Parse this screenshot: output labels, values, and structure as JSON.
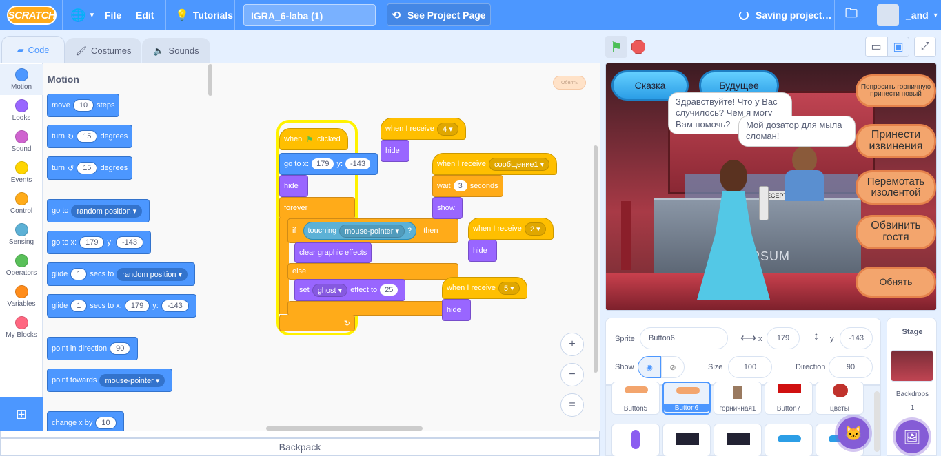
{
  "menubar": {
    "logo": "SCRATCH",
    "file": "File",
    "edit": "Edit",
    "tutorials": "Tutorials",
    "project_title": "IGRA_6-laba (1)",
    "see_project": "See Project Page",
    "saving": "Saving project…",
    "username": "_and"
  },
  "tabs": {
    "code": "Code",
    "costumes": "Costumes",
    "sounds": "Sounds"
  },
  "categories": [
    {
      "label": "Motion",
      "color": "#4c97ff"
    },
    {
      "label": "Looks",
      "color": "#9966ff"
    },
    {
      "label": "Sound",
      "color": "#cf63cf"
    },
    {
      "label": "Events",
      "color": "#ffd500"
    },
    {
      "label": "Control",
      "color": "#ffab19"
    },
    {
      "label": "Sensing",
      "color": "#5cb1d6"
    },
    {
      "label": "Operators",
      "color": "#59c059"
    },
    {
      "label": "Variables",
      "color": "#ff8c1a"
    },
    {
      "label": "My Blocks",
      "color": "#ff6680"
    }
  ],
  "palette": {
    "heading": "Motion",
    "move": {
      "a": "move",
      "n": "10",
      "b": "steps"
    },
    "turn_right": {
      "a": "turn",
      "n": "15",
      "b": "degrees"
    },
    "turn_left": {
      "a": "turn",
      "n": "15",
      "b": "degrees"
    },
    "goto": {
      "a": "go to",
      "d": "random position"
    },
    "gotoxy": {
      "a": "go to x:",
      "x": "179",
      "b": "y:",
      "y": "-143"
    },
    "glide": {
      "a": "glide",
      "n": "1",
      "b": "secs to",
      "d": "random position"
    },
    "glidexy": {
      "a": "glide",
      "n": "1",
      "b": "secs to x:",
      "x": "179",
      "c": "y:",
      "y": "-143"
    },
    "point_dir": {
      "a": "point in direction",
      "n": "90"
    },
    "point_towards": {
      "a": "point towards",
      "d": "mouse-pointer"
    },
    "change_x": {
      "a": "change x by",
      "n": "10"
    }
  },
  "script": {
    "when_flag": {
      "a": "when",
      "b": "clicked"
    },
    "gotoxy": {
      "a": "go to x:",
      "x": "179",
      "b": "y:",
      "y": "-143"
    },
    "hide1": "hide",
    "forever": "forever",
    "if": "if",
    "touching": {
      "a": "touching",
      "d": "mouse-pointer",
      "q": "?"
    },
    "then": "then",
    "clear_effects": "clear graphic effects",
    "else": "else",
    "set_effect": {
      "a": "set",
      "d": "ghost",
      "b": "effect to",
      "n": "25"
    },
    "recv4": {
      "a": "when I receive",
      "d": "4"
    },
    "hide2": "hide",
    "recv_msg": {
      "a": "when I receive",
      "d": "сообщение1"
    },
    "wait": {
      "a": "wait",
      "n": "3",
      "b": "seconds"
    },
    "show": "show",
    "recv2": {
      "a": "when I receive",
      "d": "2"
    },
    "hide3": "hide",
    "recv5": {
      "a": "when I receive",
      "d": "5"
    },
    "hide4": "hide",
    "faded_label": "Обнять"
  },
  "zoom": {
    "in": "+",
    "out": "−",
    "reset": "="
  },
  "backpack": "Backpack",
  "stage": {
    "btn_fairy": "Сказка",
    "btn_future": "Будущее",
    "btn_ask": "Попросить горничную принести новый",
    "btn_apologize": "Принести извинения",
    "btn_tape": "Перемотать изолентой",
    "btn_blame": "Обвинить гостя",
    "btn_hug": "Обнять",
    "bubble1": "Здравствуйте! Что у Вас случилось? Чем я могу Вам помочь?",
    "bubble2": "Мой дозатор для мыла сломан!",
    "sign": "IPSUM",
    "reception": "ECEPTION"
  },
  "sprite_info": {
    "sprite_label": "Sprite",
    "sprite_name": "Button6",
    "x_label": "x",
    "x": "179",
    "y_label": "y",
    "y": "-143",
    "show_label": "Show",
    "size_label": "Size",
    "size": "100",
    "direction_label": "Direction",
    "direction": "90"
  },
  "sprites": [
    "Button5",
    "Button6",
    "горничная1",
    "Button7",
    "цветы"
  ],
  "stage_panel": {
    "title": "Stage",
    "backdrops_label": "Backdrops",
    "backdrops_count": "1"
  }
}
